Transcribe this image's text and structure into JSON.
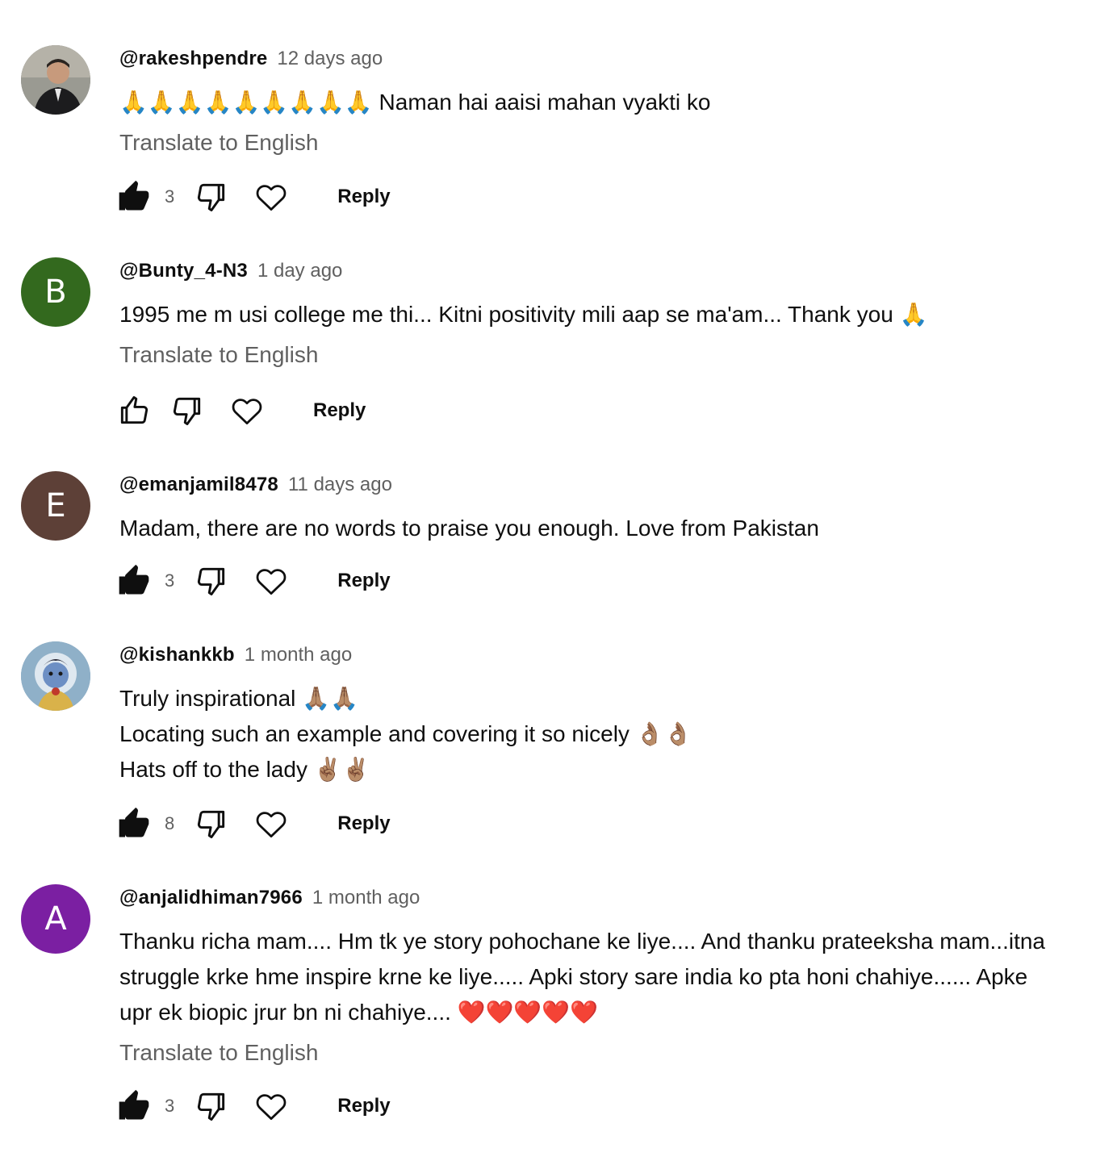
{
  "comments": [
    {
      "author": "@rakeshpendre",
      "time": "12 days ago",
      "text": "🙏🙏🙏🙏🙏🙏🙏🙏🙏 Naman hai aaisi mahan vyakti ko",
      "translate": "Translate to English",
      "likes": "3",
      "liked": true,
      "reply": "Reply",
      "avatar": {
        "type": "photo",
        "icon": "person-photo-icon",
        "bg": "#8a8a84"
      }
    },
    {
      "author": "@Bunty_4-N3",
      "time": "1 day ago",
      "text": "1995 me m usi college me thi... Kitni positivity mili aap se ma'am... Thank you 🙏",
      "translate": "Translate to English",
      "likes": "",
      "liked": false,
      "reply": "Reply",
      "avatar": {
        "type": "letter",
        "letter": "B",
        "bg": "#33691e"
      }
    },
    {
      "author": "@emanjamil8478",
      "time": "11 days ago",
      "text": "Madam, there are no words to praise you enough. Love from Pakistan",
      "translate": "",
      "likes": "3",
      "liked": true,
      "reply": "Reply",
      "avatar": {
        "type": "letter",
        "letter": "E",
        "bg": "#5d4037"
      }
    },
    {
      "author": "@kishankkb",
      "time": "1 month ago",
      "text": "Truly inspirational 🙏🏽🙏🏽\nLocating such an example and covering it so nicely 👌🏽👌🏽\nHats off to the lady ✌🏽✌🏽",
      "translate": "",
      "likes": "8",
      "liked": true,
      "reply": "Reply",
      "avatar": {
        "type": "photo",
        "icon": "krishna-photo-icon",
        "bg": "#7fa0b8"
      }
    },
    {
      "author": "@anjalidhiman7966",
      "time": "1 month ago",
      "text": "Thanku richa mam.... Hm tk ye story pohochane ke liye.... And thanku prateeksha mam...itna struggle krke hme inspire krne ke liye..... Apki story sare india ko pta honi chahiye...... Apke upr ek biopic jrur bn ni chahiye.... ❤️❤️❤️❤️❤️",
      "translate": "Translate to English",
      "likes": "3",
      "liked": true,
      "reply": "Reply",
      "avatar": {
        "type": "letter",
        "letter": "A",
        "bg": "#7b1fa2"
      }
    }
  ],
  "colors": {
    "text": "#0f0f0f",
    "secondary": "#606060",
    "background": "#ffffff"
  }
}
